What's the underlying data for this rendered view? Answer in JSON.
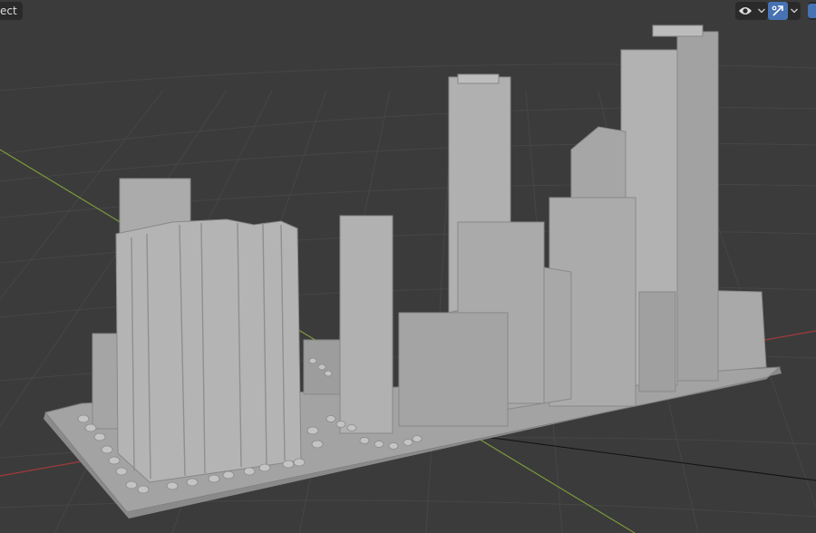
{
  "header": {
    "mode_label": "ect"
  },
  "toolbar": {
    "visibility_icon": "eye-icon",
    "dropdown_icon": "chevron-down-icon",
    "gizmo_icon": "gizmo-arrow-icon",
    "accent_color": "#4772b3"
  },
  "viewport": {
    "background": "#3b3b3b",
    "grid_color": "#454545",
    "axis_x_color": "#a33a3a",
    "axis_y_color": "#7a9a3a",
    "model_color": "#a9a9a9"
  }
}
